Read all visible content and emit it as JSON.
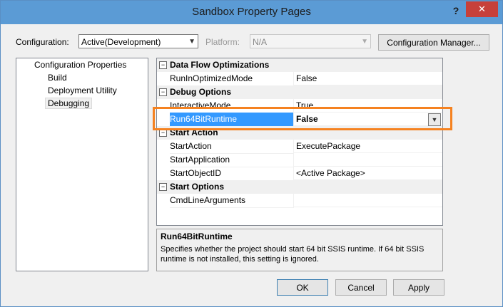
{
  "window": {
    "title": "Sandbox Property Pages",
    "help": "?",
    "close": "✕"
  },
  "config": {
    "configuration_label": "Configuration:",
    "configuration_value": "Active(Development)",
    "platform_label": "Platform:",
    "platform_value": "N/A",
    "manager_button": "Configuration Manager..."
  },
  "tree": {
    "root": "Configuration Properties",
    "items": [
      "Build",
      "Deployment Utility",
      "Debugging"
    ],
    "selected": "Debugging"
  },
  "grid": {
    "categories": [
      {
        "label": "Data Flow Optimizations",
        "toggle": "−",
        "rows": [
          {
            "name": "RunInOptimizedMode",
            "value": "False"
          }
        ]
      },
      {
        "label": "Debug Options",
        "toggle": "−",
        "rows": [
          {
            "name": "InteractiveMode",
            "value": "True"
          },
          {
            "name": "Run64BitRuntime",
            "value": "False",
            "selected": true
          }
        ]
      },
      {
        "label": "Start Action",
        "toggle": "−",
        "rows": [
          {
            "name": "StartAction",
            "value": "ExecutePackage"
          },
          {
            "name": "StartApplication",
            "value": ""
          },
          {
            "name": "StartObjectID",
            "value": "<Active Package>"
          }
        ]
      },
      {
        "label": "Start Options",
        "toggle": "−",
        "rows": [
          {
            "name": "CmdLineArguments",
            "value": ""
          }
        ]
      }
    ]
  },
  "description": {
    "title": "Run64BitRuntime",
    "text": "Specifies whether the project should start 64 bit SSIS runtime. If 64 bit SSIS runtime is not installed, this setting is ignored."
  },
  "buttons": {
    "ok": "OK",
    "cancel": "Cancel",
    "apply": "Apply"
  },
  "colors": {
    "titlebar": "#5b9bd5",
    "close": "#c7403a",
    "selection": "#3399ff",
    "highlight": "#f58220"
  }
}
